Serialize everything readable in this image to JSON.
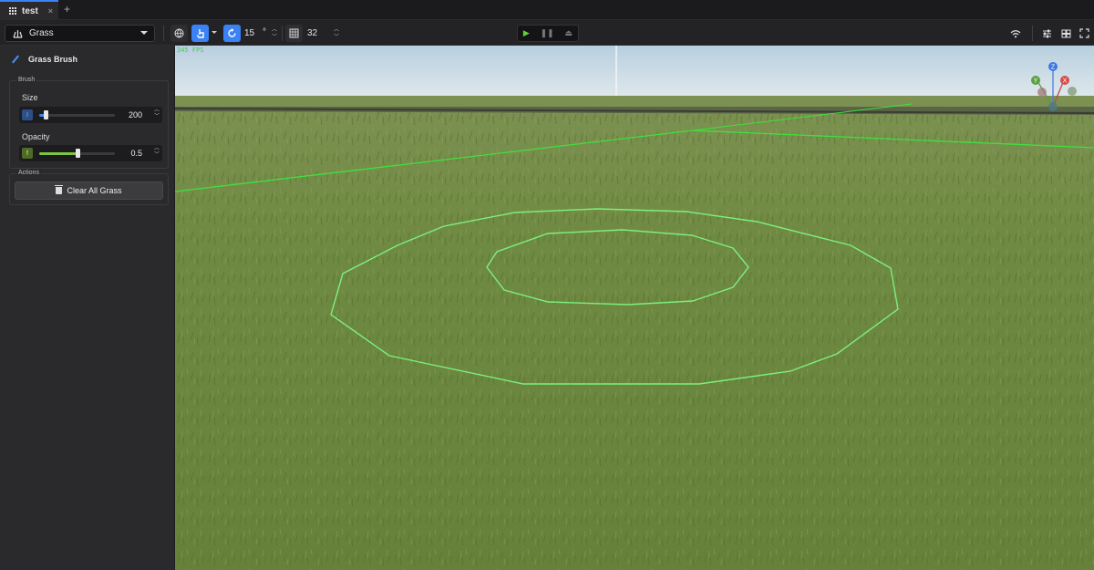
{
  "tab": {
    "name": "test",
    "close": "×",
    "add": "+"
  },
  "toolbar": {
    "mode": "Grass",
    "rotation_step": "15",
    "rotation_unit": "°",
    "grid_size": "32"
  },
  "panel": {
    "title": "Grass Brush",
    "brush_group": "Brush",
    "size_label": "Size",
    "size_tag": "I",
    "size_value": "200",
    "size_fraction": 0.08,
    "opacity_label": "Opacity",
    "opacity_tag": "f",
    "opacity_value": "0.5",
    "opacity_fraction": 0.5,
    "actions_group": "Actions",
    "clear_button": "Clear All Grass"
  },
  "viewport": {
    "fps": "345 FPS",
    "gizmo": {
      "z": "Z",
      "y": "Y",
      "x": "X"
    }
  },
  "colors": {
    "accent": "#3b82f6",
    "size_tag_bg": "#2b4f86",
    "opacity_tag_bg": "#4d6b24",
    "opacity_fill": "#7fc442",
    "selection_line": "#5cf05c",
    "sky": "#cfe0ec",
    "grass": "#6e8a3e"
  }
}
